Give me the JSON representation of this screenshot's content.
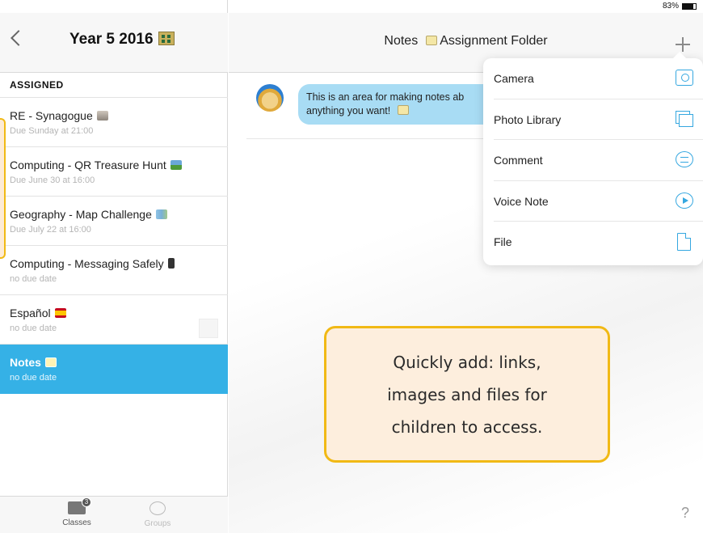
{
  "status": {
    "device": "iPad",
    "wifi_icon": "wifi-icon",
    "battery": "83%",
    "battery_level": 0.83
  },
  "sidebar": {
    "title": "Year 5 2016",
    "title_icon": "building-icon",
    "section_label": "ASSIGNED",
    "items": [
      {
        "title": "RE - Synagogue",
        "due": "Due Sunday at 21:00",
        "icon": "temple-emoji"
      },
      {
        "title": "Computing - QR Treasure Hunt",
        "due": "Due June 30 at 16:00",
        "icon": "picture-emoji"
      },
      {
        "title": "Geography - Map Challenge",
        "due": "Due July 22 at 16:00",
        "icon": "map-emoji"
      },
      {
        "title": "Computing - Messaging Safely",
        "due": "no due date",
        "icon": "phone-emoji"
      },
      {
        "title": "Español",
        "due": "no due date",
        "icon": "spain-flag-emoji"
      },
      {
        "title": "Notes",
        "due": "no due date",
        "icon": "memo-emoji",
        "selected": true
      }
    ]
  },
  "tabbar": {
    "classes_label": "Classes",
    "classes_badge": "3",
    "groups_label": "Groups"
  },
  "main": {
    "title_prefix": "Notes",
    "title_suffix": "Assignment Folder",
    "note_text": "This is an area for making notes ab anything you want!"
  },
  "add_menu": {
    "items": [
      {
        "label": "Camera",
        "icon": "camera-icon"
      },
      {
        "label": "Photo Library",
        "icon": "photo-library-icon"
      },
      {
        "label": "Comment",
        "icon": "comment-icon"
      },
      {
        "label": "Voice Note",
        "icon": "voice-note-icon"
      },
      {
        "label": "File",
        "icon": "file-icon"
      }
    ]
  },
  "callout": {
    "line1": "Quickly add: links,",
    "line2": "images and files for",
    "line3": "children to access."
  },
  "help": "?",
  "colors": {
    "accent": "#35b1e6",
    "callout_border": "#f1b915",
    "callout_fill": "#fdeedd",
    "bubble": "#a8dcf4"
  }
}
